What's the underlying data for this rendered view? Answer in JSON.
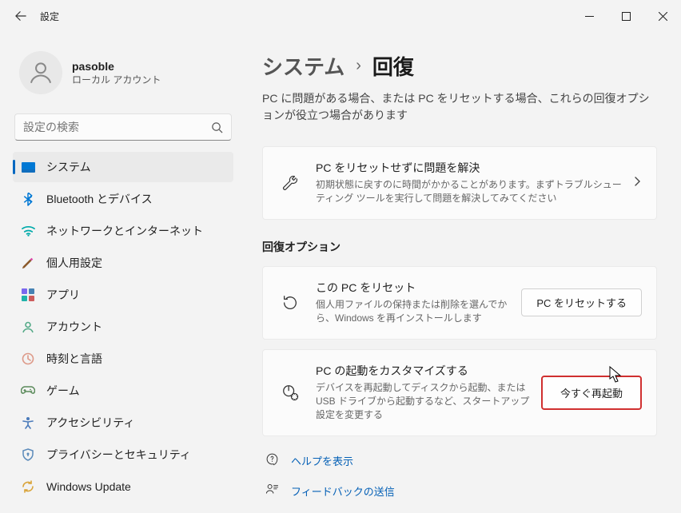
{
  "window": {
    "title": "設定"
  },
  "user": {
    "name": "pasoble",
    "subtitle": "ローカル アカウント"
  },
  "search": {
    "placeholder": "設定の検索"
  },
  "nav": [
    {
      "id": "system",
      "label": "システム",
      "selected": true
    },
    {
      "id": "bluetooth",
      "label": "Bluetooth とデバイス",
      "selected": false
    },
    {
      "id": "network",
      "label": "ネットワークとインターネット",
      "selected": false
    },
    {
      "id": "personalization",
      "label": "個人用設定",
      "selected": false
    },
    {
      "id": "apps",
      "label": "アプリ",
      "selected": false
    },
    {
      "id": "accounts",
      "label": "アカウント",
      "selected": false
    },
    {
      "id": "time",
      "label": "時刻と言語",
      "selected": false
    },
    {
      "id": "gaming",
      "label": "ゲーム",
      "selected": false
    },
    {
      "id": "accessibility",
      "label": "アクセシビリティ",
      "selected": false
    },
    {
      "id": "privacy",
      "label": "プライバシーとセキュリティ",
      "selected": false
    },
    {
      "id": "update",
      "label": "Windows Update",
      "selected": false
    }
  ],
  "breadcrumb": {
    "parent": "システム",
    "current": "回復"
  },
  "page_description": "PC に問題がある場合、または PC をリセットする場合、これらの回復オプションが役立つ場合があります",
  "troubleshoot": {
    "title": "PC をリセットせずに問題を解決",
    "desc": "初期状態に戻すのに時間がかかることがあります。まずトラブルシューティング ツールを実行して問題を解決してみてください"
  },
  "section": {
    "title": "回復オプション"
  },
  "reset": {
    "title": "この PC をリセット",
    "desc": "個人用ファイルの保持または削除を選んでから、Windows を再インストールします",
    "button": "PC をリセットする"
  },
  "advanced": {
    "title": "PC の起動をカスタマイズする",
    "desc": "デバイスを再起動してディスクから起動、または USB ドライブから起動するなど、スタートアップ設定を変更する",
    "button": "今すぐ再起動"
  },
  "links": {
    "help": "ヘルプを表示",
    "feedback": "フィードバックの送信"
  },
  "colors": {
    "accent": "#0067c0",
    "highlight_border": "#d03030",
    "link": "#0560b6"
  }
}
